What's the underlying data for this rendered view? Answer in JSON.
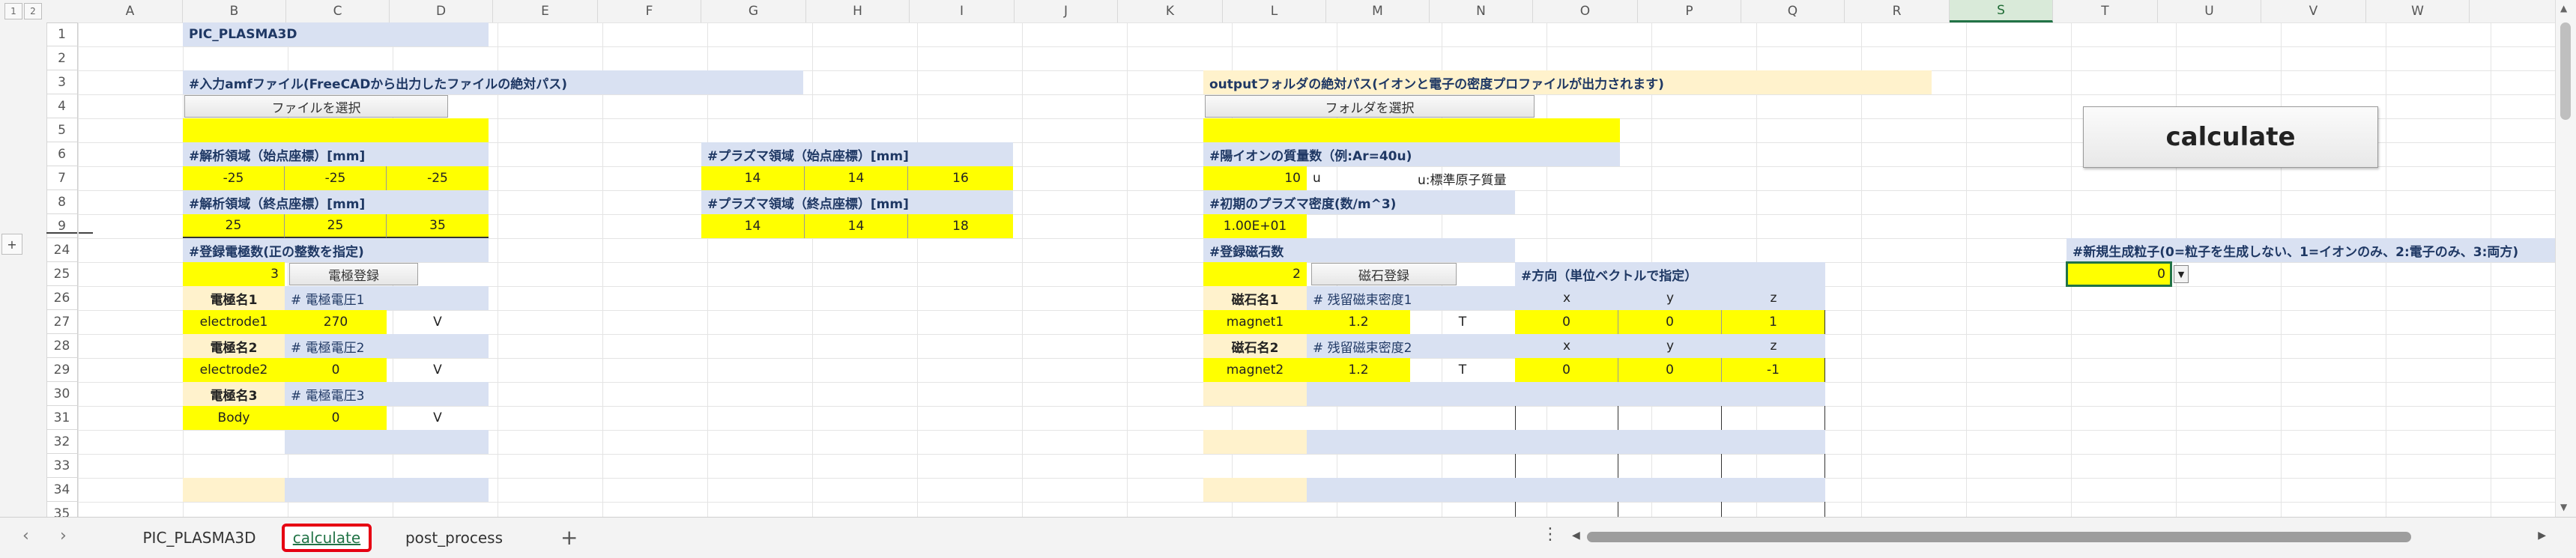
{
  "outline": {
    "levels": [
      "1",
      "2"
    ],
    "expand": "+"
  },
  "columns": [
    "A",
    "B",
    "C",
    "D",
    "E",
    "F",
    "G",
    "H",
    "I",
    "J",
    "K",
    "L",
    "M",
    "N",
    "O",
    "P",
    "Q",
    "R",
    "S",
    "T",
    "U",
    "V",
    "W"
  ],
  "rows": [
    "1",
    "2",
    "3",
    "4",
    "5",
    "6",
    "7",
    "8",
    "9",
    "24",
    "25",
    "26",
    "27",
    "28",
    "29",
    "30",
    "31",
    "32",
    "33",
    "34",
    "35"
  ],
  "selected_column": "S",
  "sheet": {
    "title": "PIC_PLASMA3D",
    "amf": {
      "label": "#入力amfファイル(FreeCADから出力したファイルの絶対パス)",
      "button": "ファイルを選択"
    },
    "output": {
      "label": "outputフォルダの絶対パス(イオンと電子の密度プロファイルが出力されます)",
      "button": "フォルダを選択"
    },
    "calculate_button": "calculate",
    "domain_start": {
      "label": "#解析領域（始点座標）[mm]",
      "values": [
        "-25",
        "-25",
        "-25"
      ]
    },
    "domain_end": {
      "label": "#解析領域（終点座標）[mm]",
      "values": [
        "25",
        "25",
        "35"
      ]
    },
    "plasma_start": {
      "label": "#プラズマ領域（始点座標）[mm]",
      "values": [
        "14",
        "14",
        "16"
      ]
    },
    "plasma_end": {
      "label": "#プラズマ領域（終点座標）[mm]",
      "values": [
        "14",
        "14",
        "18"
      ]
    },
    "ion_mass": {
      "label": "#陽イオンの質量数（例:Ar=40u)",
      "value": "10",
      "unit": "u",
      "note": "u:標準原子質量"
    },
    "plasma_density": {
      "label": "#初期のプラズマ密度(数/m^3)",
      "value": "1.00E+01"
    },
    "electrodes": {
      "label": "#登録電極数(正の整数を指定)",
      "count": "3",
      "register_button": "電極登録",
      "items": [
        {
          "name_header": "電極名1",
          "name": "electrode1",
          "voltage_label": "# 電極電圧1",
          "voltage": "270",
          "unit": "V"
        },
        {
          "name_header": "電極名2",
          "name": "electrode2",
          "voltage_label": "# 電極電圧2",
          "voltage": "0",
          "unit": "V"
        },
        {
          "name_header": "電極名3",
          "name": "Body",
          "voltage_label": "# 電極電圧3",
          "voltage": "0",
          "unit": "V"
        }
      ]
    },
    "magnets": {
      "label": "#登録磁石数",
      "count": "2",
      "register_button": "磁石登録",
      "direction_label": "#方向（単位ベクトルで指定）",
      "axes": [
        "x",
        "y",
        "z"
      ],
      "items": [
        {
          "name_header": "磁石名1",
          "name": "magnet1",
          "flux_label": "# 残留磁束密度1",
          "flux": "1.2",
          "unit": "T",
          "dir": [
            "0",
            "0",
            "1"
          ]
        },
        {
          "name_header": "磁石名2",
          "name": "magnet2",
          "flux_label": "# 残留磁束密度2",
          "flux": "1.2",
          "unit": "T",
          "dir": [
            "0",
            "0",
            "-1"
          ]
        }
      ]
    },
    "particles": {
      "label": "#新規生成粒子(0=粒子を生成しない、1=イオンのみ、2:電子のみ、3:両方)",
      "value": "0"
    }
  },
  "tabs": {
    "prev": "‹",
    "next": "›",
    "items": [
      "PIC_PLASMA3D",
      "calculate",
      "post_process"
    ],
    "active": "calculate",
    "add": "+",
    "options": "⋮"
  },
  "scroll": {
    "left": "◀",
    "right": "▶",
    "up": "▲",
    "down": "▼"
  }
}
